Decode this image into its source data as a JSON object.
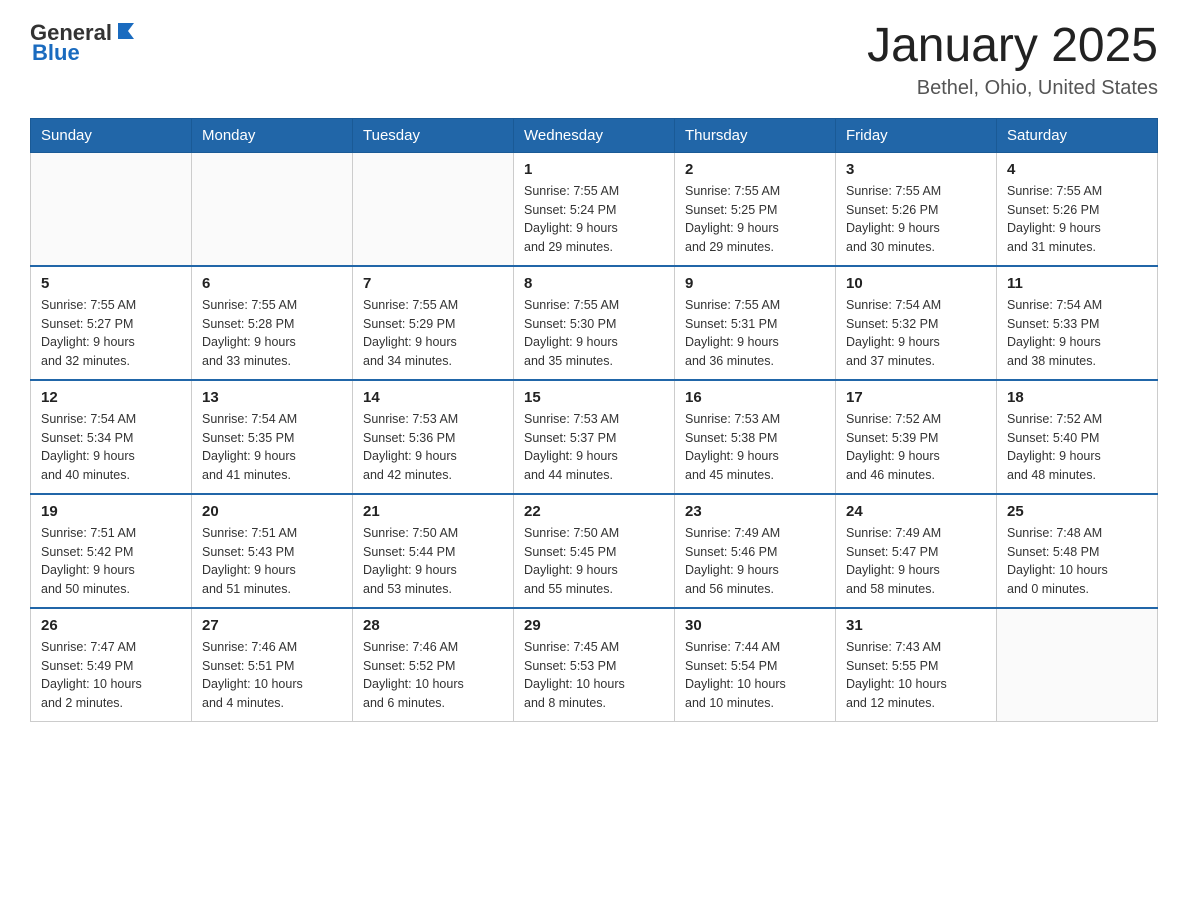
{
  "header": {
    "logo_general": "General",
    "logo_blue": "Blue",
    "month_title": "January 2025",
    "location": "Bethel, Ohio, United States"
  },
  "days_of_week": [
    "Sunday",
    "Monday",
    "Tuesday",
    "Wednesday",
    "Thursday",
    "Friday",
    "Saturday"
  ],
  "weeks": [
    [
      {
        "day": "",
        "info": ""
      },
      {
        "day": "",
        "info": ""
      },
      {
        "day": "",
        "info": ""
      },
      {
        "day": "1",
        "info": "Sunrise: 7:55 AM\nSunset: 5:24 PM\nDaylight: 9 hours\nand 29 minutes."
      },
      {
        "day": "2",
        "info": "Sunrise: 7:55 AM\nSunset: 5:25 PM\nDaylight: 9 hours\nand 29 minutes."
      },
      {
        "day": "3",
        "info": "Sunrise: 7:55 AM\nSunset: 5:26 PM\nDaylight: 9 hours\nand 30 minutes."
      },
      {
        "day": "4",
        "info": "Sunrise: 7:55 AM\nSunset: 5:26 PM\nDaylight: 9 hours\nand 31 minutes."
      }
    ],
    [
      {
        "day": "5",
        "info": "Sunrise: 7:55 AM\nSunset: 5:27 PM\nDaylight: 9 hours\nand 32 minutes."
      },
      {
        "day": "6",
        "info": "Sunrise: 7:55 AM\nSunset: 5:28 PM\nDaylight: 9 hours\nand 33 minutes."
      },
      {
        "day": "7",
        "info": "Sunrise: 7:55 AM\nSunset: 5:29 PM\nDaylight: 9 hours\nand 34 minutes."
      },
      {
        "day": "8",
        "info": "Sunrise: 7:55 AM\nSunset: 5:30 PM\nDaylight: 9 hours\nand 35 minutes."
      },
      {
        "day": "9",
        "info": "Sunrise: 7:55 AM\nSunset: 5:31 PM\nDaylight: 9 hours\nand 36 minutes."
      },
      {
        "day": "10",
        "info": "Sunrise: 7:54 AM\nSunset: 5:32 PM\nDaylight: 9 hours\nand 37 minutes."
      },
      {
        "day": "11",
        "info": "Sunrise: 7:54 AM\nSunset: 5:33 PM\nDaylight: 9 hours\nand 38 minutes."
      }
    ],
    [
      {
        "day": "12",
        "info": "Sunrise: 7:54 AM\nSunset: 5:34 PM\nDaylight: 9 hours\nand 40 minutes."
      },
      {
        "day": "13",
        "info": "Sunrise: 7:54 AM\nSunset: 5:35 PM\nDaylight: 9 hours\nand 41 minutes."
      },
      {
        "day": "14",
        "info": "Sunrise: 7:53 AM\nSunset: 5:36 PM\nDaylight: 9 hours\nand 42 minutes."
      },
      {
        "day": "15",
        "info": "Sunrise: 7:53 AM\nSunset: 5:37 PM\nDaylight: 9 hours\nand 44 minutes."
      },
      {
        "day": "16",
        "info": "Sunrise: 7:53 AM\nSunset: 5:38 PM\nDaylight: 9 hours\nand 45 minutes."
      },
      {
        "day": "17",
        "info": "Sunrise: 7:52 AM\nSunset: 5:39 PM\nDaylight: 9 hours\nand 46 minutes."
      },
      {
        "day": "18",
        "info": "Sunrise: 7:52 AM\nSunset: 5:40 PM\nDaylight: 9 hours\nand 48 minutes."
      }
    ],
    [
      {
        "day": "19",
        "info": "Sunrise: 7:51 AM\nSunset: 5:42 PM\nDaylight: 9 hours\nand 50 minutes."
      },
      {
        "day": "20",
        "info": "Sunrise: 7:51 AM\nSunset: 5:43 PM\nDaylight: 9 hours\nand 51 minutes."
      },
      {
        "day": "21",
        "info": "Sunrise: 7:50 AM\nSunset: 5:44 PM\nDaylight: 9 hours\nand 53 minutes."
      },
      {
        "day": "22",
        "info": "Sunrise: 7:50 AM\nSunset: 5:45 PM\nDaylight: 9 hours\nand 55 minutes."
      },
      {
        "day": "23",
        "info": "Sunrise: 7:49 AM\nSunset: 5:46 PM\nDaylight: 9 hours\nand 56 minutes."
      },
      {
        "day": "24",
        "info": "Sunrise: 7:49 AM\nSunset: 5:47 PM\nDaylight: 9 hours\nand 58 minutes."
      },
      {
        "day": "25",
        "info": "Sunrise: 7:48 AM\nSunset: 5:48 PM\nDaylight: 10 hours\nand 0 minutes."
      }
    ],
    [
      {
        "day": "26",
        "info": "Sunrise: 7:47 AM\nSunset: 5:49 PM\nDaylight: 10 hours\nand 2 minutes."
      },
      {
        "day": "27",
        "info": "Sunrise: 7:46 AM\nSunset: 5:51 PM\nDaylight: 10 hours\nand 4 minutes."
      },
      {
        "day": "28",
        "info": "Sunrise: 7:46 AM\nSunset: 5:52 PM\nDaylight: 10 hours\nand 6 minutes."
      },
      {
        "day": "29",
        "info": "Sunrise: 7:45 AM\nSunset: 5:53 PM\nDaylight: 10 hours\nand 8 minutes."
      },
      {
        "day": "30",
        "info": "Sunrise: 7:44 AM\nSunset: 5:54 PM\nDaylight: 10 hours\nand 10 minutes."
      },
      {
        "day": "31",
        "info": "Sunrise: 7:43 AM\nSunset: 5:55 PM\nDaylight: 10 hours\nand 12 minutes."
      },
      {
        "day": "",
        "info": ""
      }
    ]
  ]
}
